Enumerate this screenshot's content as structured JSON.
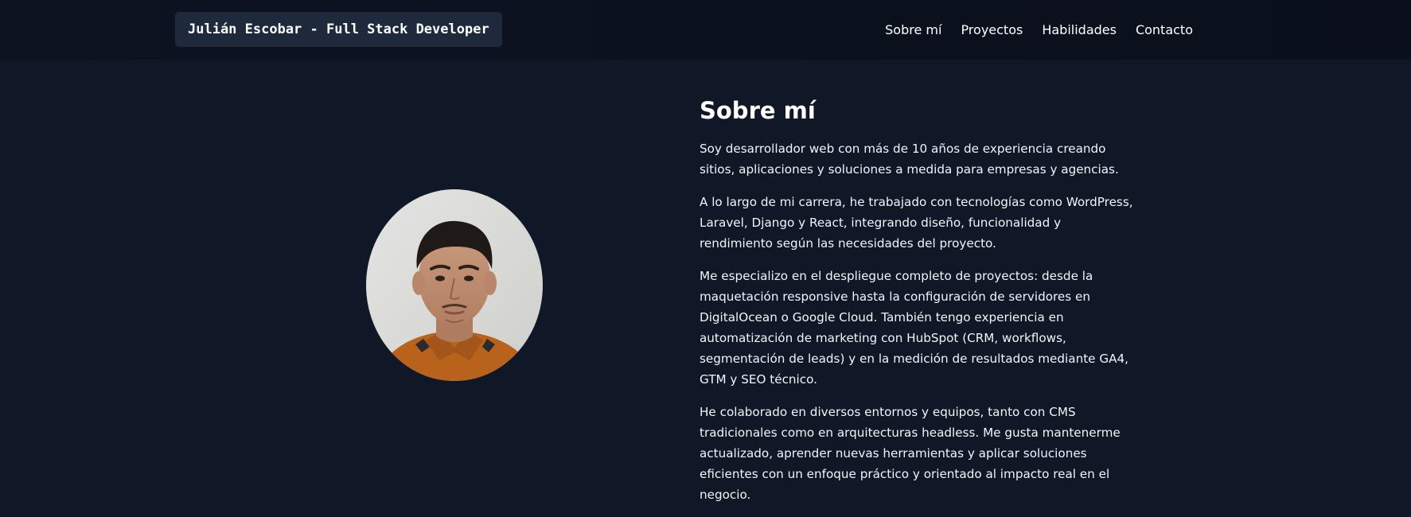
{
  "header": {
    "brand": "Julián Escobar - Full Stack Developer",
    "nav": [
      {
        "label": "Sobre mí"
      },
      {
        "label": "Proyectos"
      },
      {
        "label": "Habilidades"
      },
      {
        "label": "Contacto"
      }
    ]
  },
  "about": {
    "title": "Sobre mí",
    "paragraphs": [
      "Soy desarrollador web con más de 10 años de experiencia creando sitios, aplicaciones y soluciones a medida para empresas y agencias.",
      "A lo largo de mi carrera, he trabajado con tecnologías como WordPress, Laravel, Django y React, integrando diseño, funcionalidad y rendimiento según las necesidades del proyecto.",
      "Me especializo en el despliegue completo de proyectos: desde la maquetación responsive hasta la configuración de servidores en DigitalOcean o Google Cloud. También tengo experiencia en automatización de marketing con HubSpot (CRM, workflows, segmentación de leads) y en la medición de resultados mediante GA4, GTM y SEO técnico.",
      "He colaborado en diversos entornos y equipos, tanto con CMS tradicionales como en arquitecturas headless. Me gusta mantenerme actualizado, aprender nuevas herramientas y aplicar soluciones eficientes con un enfoque práctico y orientado al impacto real en el negocio."
    ]
  },
  "colors": {
    "page_background": "#101726",
    "navbar_background": "#0b111e",
    "brand_background": "#1e293b",
    "text": "#ffffff",
    "shirt": "#b8621c"
  }
}
